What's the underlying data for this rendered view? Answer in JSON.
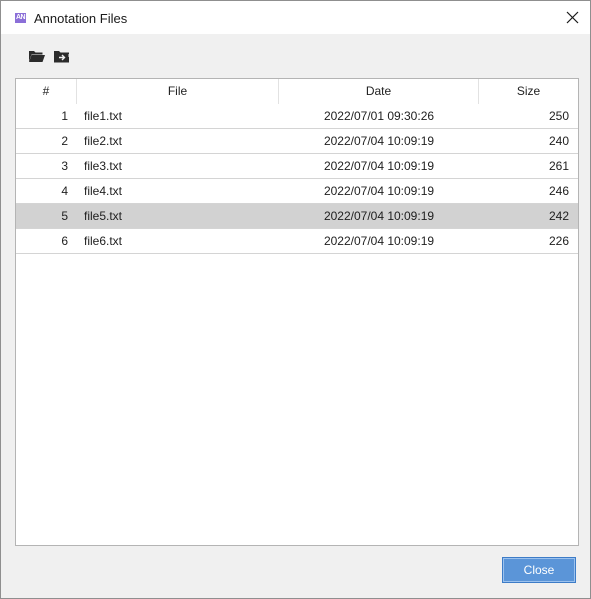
{
  "window": {
    "title": "Annotation Files",
    "app_icon_text": "AN",
    "app_icon_color": "#8b6fd8"
  },
  "toolbar": {
    "buttons": [
      {
        "icon": "folder-open-icon"
      },
      {
        "icon": "folder-move-icon"
      }
    ]
  },
  "table": {
    "columns": [
      "#",
      "File",
      "Date",
      "Size"
    ],
    "rows": [
      {
        "num": "1",
        "file": "file1.txt",
        "date": "2022/07/01 09:30:26",
        "size": "250"
      },
      {
        "num": "2",
        "file": "file2.txt",
        "date": "2022/07/04 10:09:19",
        "size": "240"
      },
      {
        "num": "3",
        "file": "file3.txt",
        "date": "2022/07/04 10:09:19",
        "size": "261"
      },
      {
        "num": "4",
        "file": "file4.txt",
        "date": "2022/07/04 10:09:19",
        "size": "246"
      },
      {
        "num": "5",
        "file": "file5.txt",
        "date": "2022/07/04 10:09:19",
        "size": "242"
      },
      {
        "num": "6",
        "file": "file6.txt",
        "date": "2022/07/04 10:09:19",
        "size": "226"
      }
    ],
    "selected_row": 4,
    "selection_color": "#d2d2d2"
  },
  "footer": {
    "close_label": "Close",
    "close_color": "#5b95d8"
  }
}
